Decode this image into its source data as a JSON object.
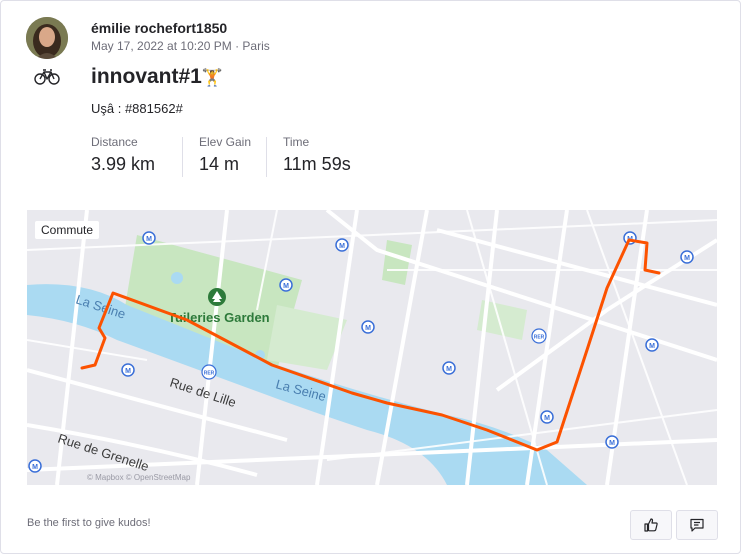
{
  "athlete": {
    "name": "émilie rochefort1850",
    "timestamp": "May 17, 2022 at 10:20 PM · Paris"
  },
  "activity": {
    "sport_icon": "bike-icon",
    "title": "innovant#1",
    "title_emoji": "🏋",
    "description": "Uşâ : #881562#"
  },
  "stats": [
    {
      "label": "Distance",
      "value": "3.99 km"
    },
    {
      "label": "Elev Gain",
      "value": "14 m"
    },
    {
      "label": "Time",
      "value": "11m 59s"
    }
  ],
  "map": {
    "badge": "Commute",
    "labels": {
      "garden": "Tuileries Garden",
      "river_1": "La Seine",
      "river_2": "La Seine",
      "street_1": "Rue de Lille",
      "street_2": "Rue de Grenelle",
      "attribution": "© Mapbox © OpenStreetMap",
      "rer_1": "RER",
      "rer_2": "RER",
      "metro": "M"
    },
    "colors": {
      "route": "#fc5200",
      "water": "#aadaf2",
      "park": "#c8e6c0",
      "land": "#e9e9ee",
      "road": "#ffffff"
    }
  },
  "footer": {
    "kudos_text": "Be the first to give kudos!",
    "kudos_icon": "thumbs-up-icon",
    "comment_icon": "comment-icon"
  }
}
